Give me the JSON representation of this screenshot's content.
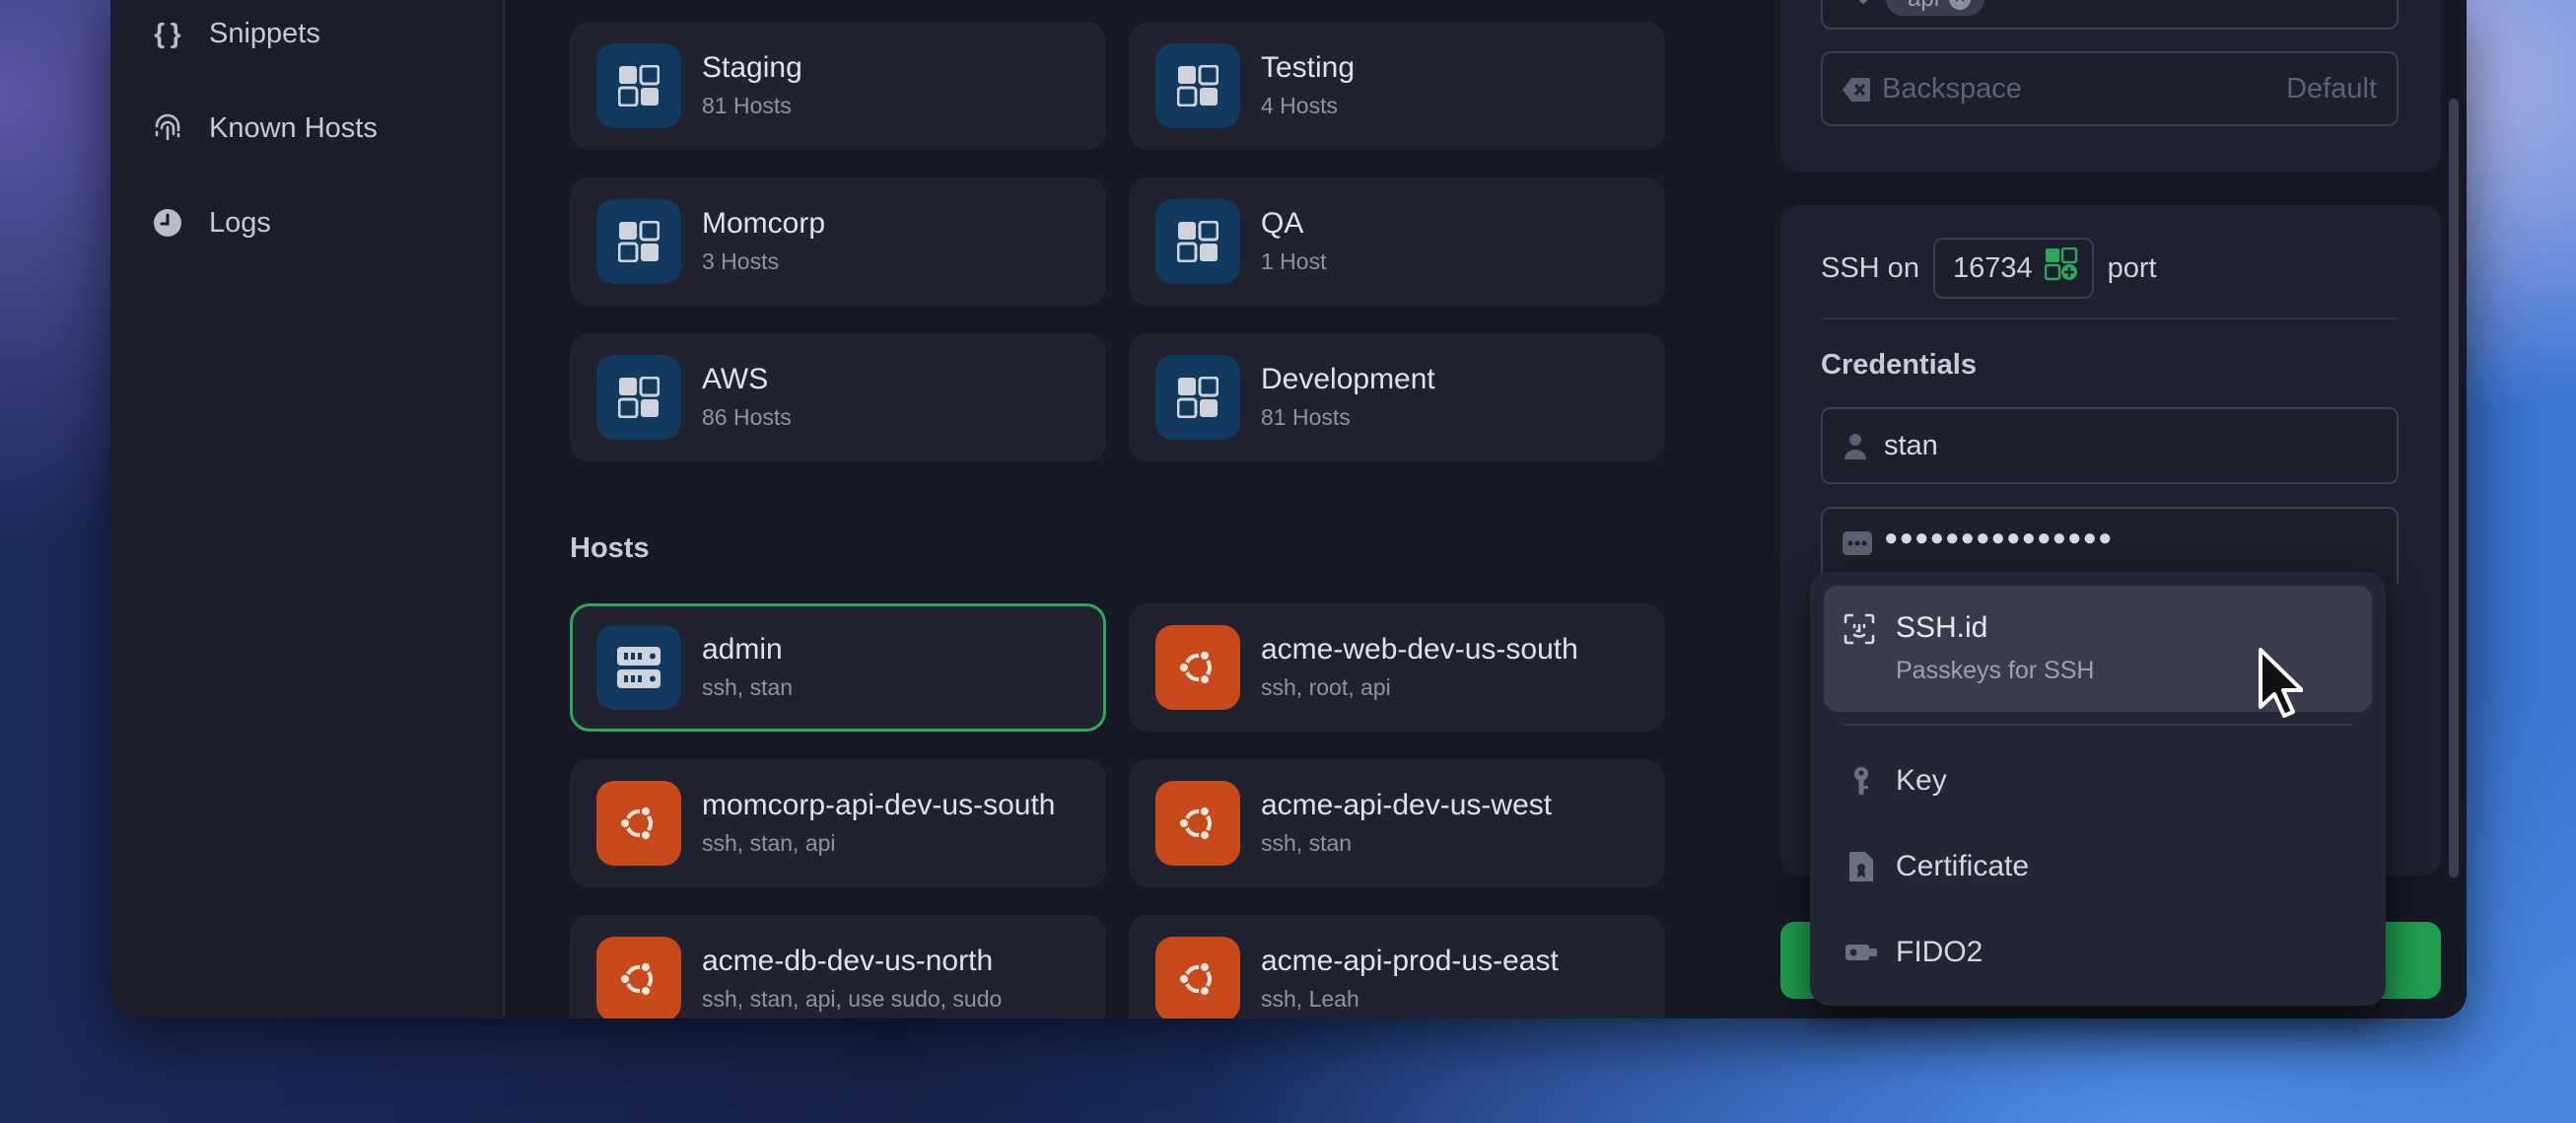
{
  "sidebar": {
    "items": [
      {
        "label": "Snippets",
        "icon": "braces-icon"
      },
      {
        "label": "Known Hosts",
        "icon": "fingerprint-icon"
      },
      {
        "label": "Logs",
        "icon": "clock-icon"
      }
    ]
  },
  "groups": [
    {
      "name": "Staging",
      "count": "81 Hosts"
    },
    {
      "name": "Testing",
      "count": "4 Hosts"
    },
    {
      "name": "Momcorp",
      "count": "3 Hosts"
    },
    {
      "name": "QA",
      "count": "1 Host"
    },
    {
      "name": "AWS",
      "count": "86 Hosts"
    },
    {
      "name": "Development",
      "count": "81 Hosts"
    }
  ],
  "hosts_section": {
    "title": "Hosts"
  },
  "hosts": [
    {
      "name": "admin",
      "tags": "ssh, stan",
      "icon": "server-icon"
    },
    {
      "name": "acme-web-dev-us-south",
      "tags": "ssh, root, api",
      "icon": "ubuntu-icon"
    },
    {
      "name": "momcorp-api-dev-us-south",
      "tags": "ssh, stan, api",
      "icon": "ubuntu-icon"
    },
    {
      "name": "acme-api-dev-us-west",
      "tags": "ssh, stan",
      "icon": "ubuntu-icon"
    },
    {
      "name": "acme-db-dev-us-north",
      "tags": "ssh, stan, api, use sudo, sudo",
      "icon": "ubuntu-icon"
    },
    {
      "name": "acme-api-prod-us-east",
      "tags": "ssh, Leah",
      "icon": "ubuntu-icon"
    }
  ],
  "keyboard": {
    "chip": "api",
    "backspace_label": "Backspace",
    "backspace_value": "Default"
  },
  "connection": {
    "ssh_on": "SSH on",
    "port": "16734",
    "port_suffix": "port",
    "credentials_title": "Credentials",
    "username": "stan",
    "password_masked": "●●●●●●●●●●●●●●●"
  },
  "auth_dropdown": {
    "items": [
      {
        "label": "SSH.id",
        "sub": "Passkeys for SSH",
        "icon": "face-scan-icon"
      },
      {
        "label": "Key",
        "icon": "key-icon"
      },
      {
        "label": "Certificate",
        "icon": "certificate-icon"
      },
      {
        "label": "FIDO2",
        "icon": "fido-icon"
      }
    ]
  },
  "colors": {
    "window_bg": "#161925",
    "card_bg": "#20232f",
    "group_icon_bg": "#123a5f",
    "ubuntu_orange": "#c84a1c",
    "selected_border": "#2fa65a",
    "connect_green": "#1f9e4f"
  }
}
